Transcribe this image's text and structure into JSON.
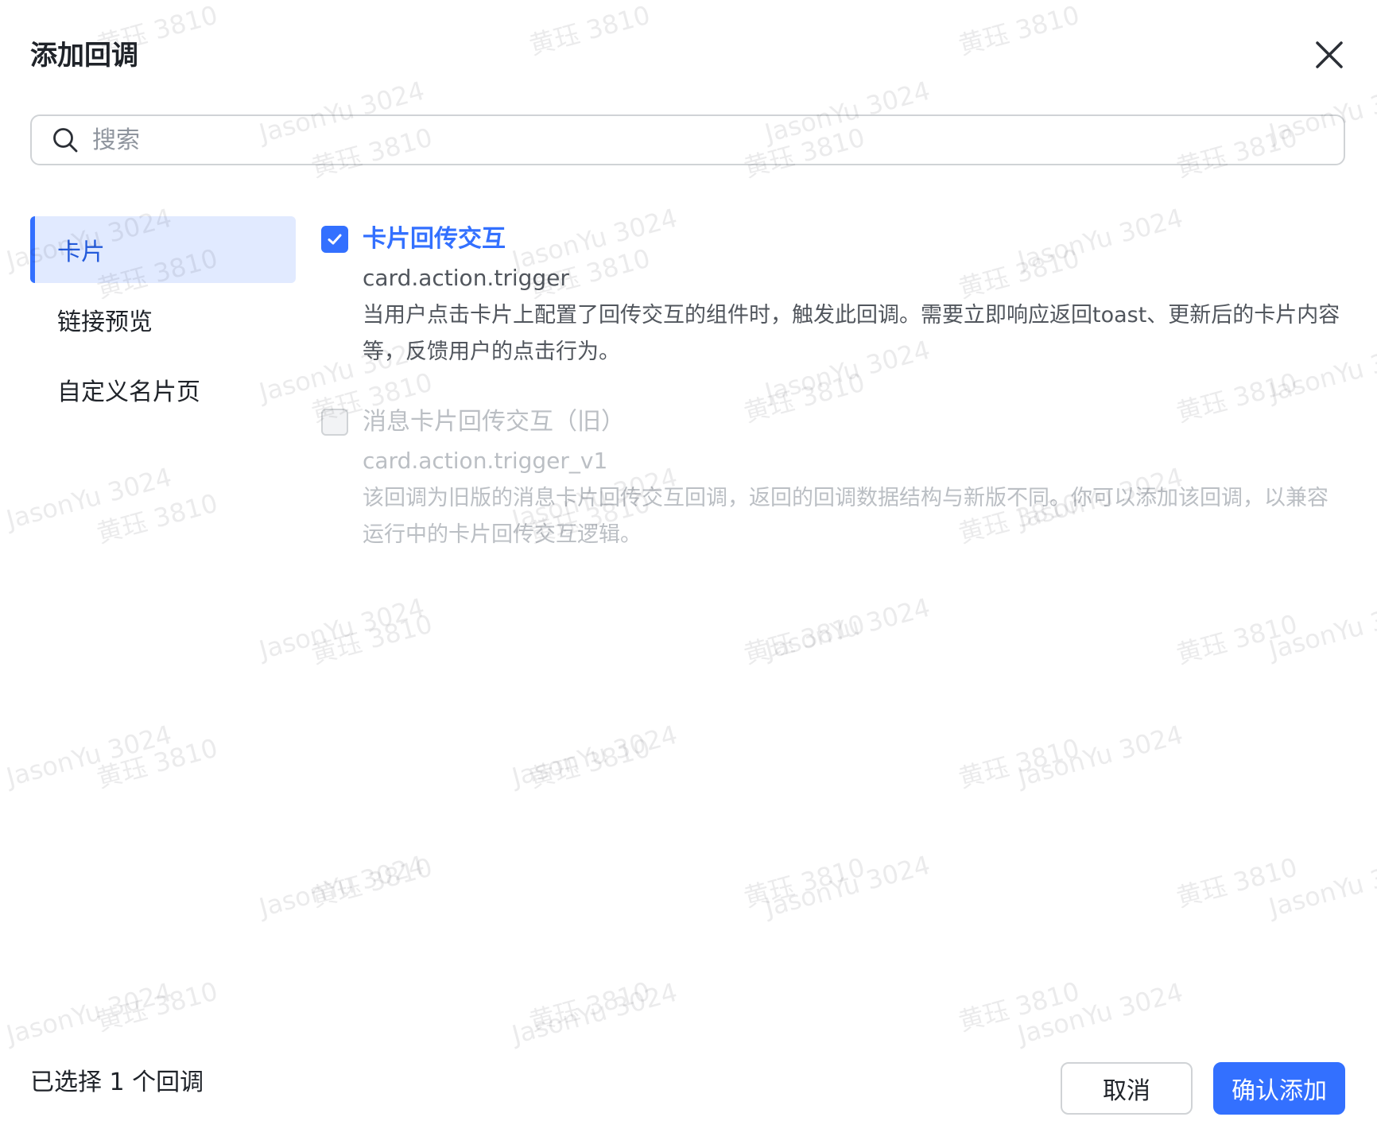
{
  "dialog": {
    "title": "添加回调"
  },
  "search": {
    "placeholder": "搜索",
    "value": ""
  },
  "sidebar": {
    "items": [
      {
        "label": "卡片",
        "active": true
      },
      {
        "label": "链接预览",
        "active": false
      },
      {
        "label": "自定义名片页",
        "active": false
      }
    ]
  },
  "options": [
    {
      "title": "卡片回传交互",
      "code": "card.action.trigger",
      "description": "当用户点击卡片上配置了回传交互的组件时，触发此回调。需要立即响应返回toast、更新后的卡片内容等，反馈用户的点击行为。",
      "checked": true,
      "enabled": true
    },
    {
      "title": "消息卡片回传交互（旧）",
      "code": "card.action.trigger_v1",
      "description": "该回调为旧版的消息卡片回传交互回调，返回的回调数据结构与新版不同。你可以添加该回调，以兼容运行中的卡片回传交互逻辑。",
      "checked": false,
      "enabled": false
    }
  ],
  "footer": {
    "status": "已选择 1 个回调",
    "cancel_label": "取消",
    "confirm_label": "确认添加"
  },
  "watermark": {
    "texts": [
      "黄珏 3810",
      "JasonYu 3024"
    ]
  },
  "colors": {
    "accent": "#3370ff",
    "active_bg": "#e1eaff",
    "text_primary": "#1f2329",
    "text_secondary": "#51565d",
    "text_disabled": "#bbbfc4",
    "border": "#d0d3d6"
  }
}
